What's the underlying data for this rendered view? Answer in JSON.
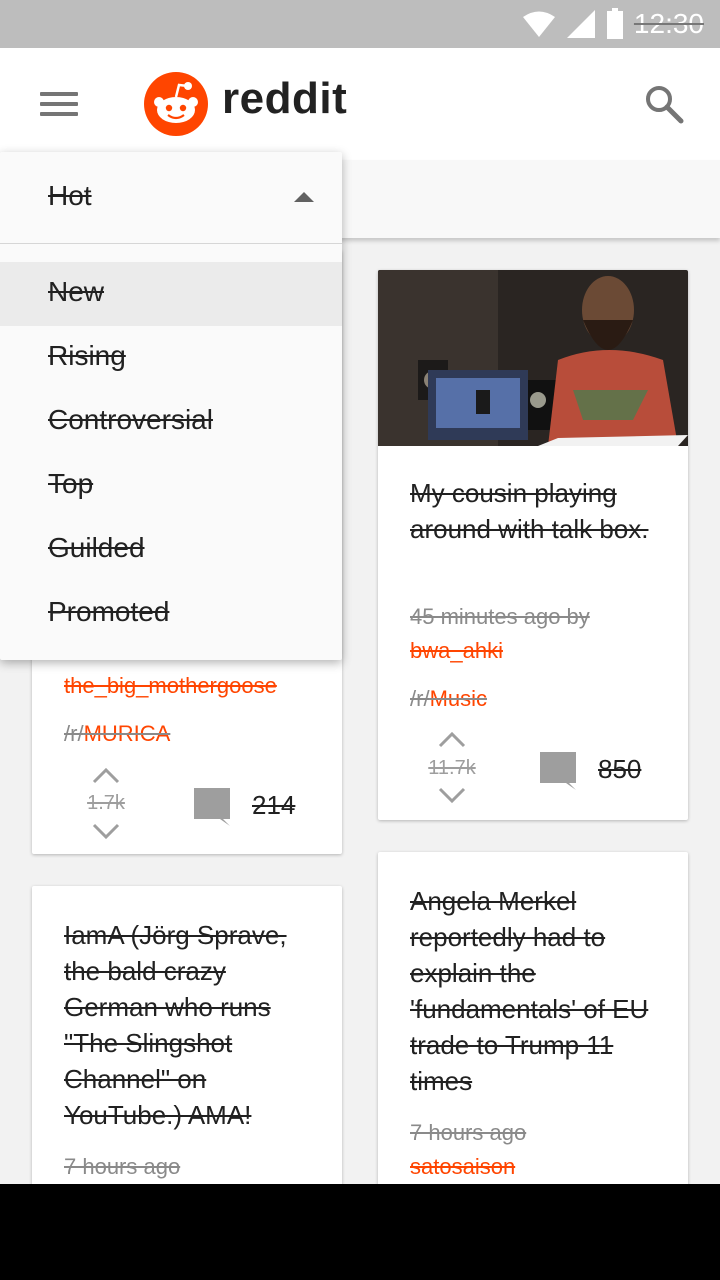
{
  "status_bar": {
    "time": "12:30"
  },
  "app_bar": {
    "brand": "reddit"
  },
  "sort_menu": {
    "current": "Hot",
    "options": [
      "New",
      "Rising",
      "Controversial",
      "Top",
      "Guilded",
      "Promoted"
    ],
    "highlighted": "New"
  },
  "posts": [
    {
      "author": "the_big_mothergoose",
      "subreddit_prefix": "/r/",
      "subreddit": "MURICA",
      "votes": "1.7k",
      "comments": "214"
    },
    {
      "title": "My cousin playing around with talk box.",
      "time": "45 minutes ago by",
      "author": "bwa_ahki",
      "subreddit_prefix": "/r/",
      "subreddit": "Music",
      "votes": "11.7k",
      "comments": "850"
    },
    {
      "title": "IamA (Jörg Sprave, the bald crazy German who runs \"The Slingshot Channel\" on YouTube.) AMA!",
      "time": "7 hours ago"
    },
    {
      "title": "Angela Merkel reportedly had to explain the 'fundamentals' of EU trade to Trump 11 times",
      "time": "7 hours ago",
      "author": "satosaison"
    }
  ],
  "colors": {
    "accent": "#ff4500",
    "status_bar": "#bdbdbd"
  }
}
